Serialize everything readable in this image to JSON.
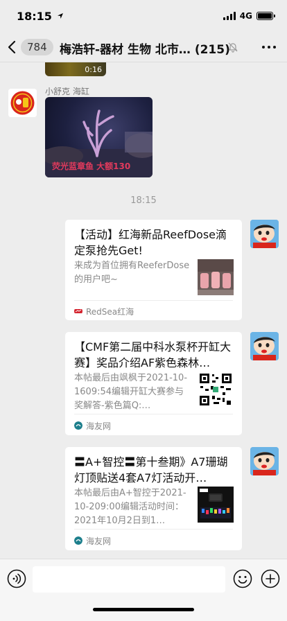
{
  "status_bar": {
    "time": "18:15",
    "network": "4G"
  },
  "nav": {
    "unread_count": "784",
    "title": "梅浩轩-器材 生物 北市…",
    "member_count": "(215)"
  },
  "chat": {
    "video": {
      "duration": "0:16"
    },
    "photo_message": {
      "sender_name": "小舒克 海缸",
      "caption": "荧光蓝章鱼  大额130"
    },
    "timestamp": "18:15",
    "cards": [
      {
        "title": "【活动】红海新品ReefDose滴定泵抢先Get!",
        "description": "来成为首位拥有ReeferDose的用户吧~",
        "source": "RedSea红海",
        "source_icon": "redsea-logo-icon"
      },
      {
        "title": "【CMF第二届中科水泵杯开缸大赛】奖品介绍AF紫色森林…",
        "description": "本帖最后由飒枫于2021-10-1609:54编辑开缸大赛参与奖解答-紫色篇Q:…",
        "source": "海友网",
        "source_icon": "haiyou-logo-icon"
      },
      {
        "title": "〓A+智控〓第十叁期》A7珊瑚灯顶贴送4套A7灯活动开…",
        "description": "本帖最后由A+智控于2021-10-209:00编辑活动时间：2021年10月2日到1…",
        "source": "海友网",
        "source_icon": "haiyou-logo-icon"
      }
    ]
  },
  "input_bar": {
    "placeholder": ""
  },
  "colors": {
    "background": "#ededed",
    "card": "#ffffff",
    "caption_red": "#e23a5c"
  }
}
